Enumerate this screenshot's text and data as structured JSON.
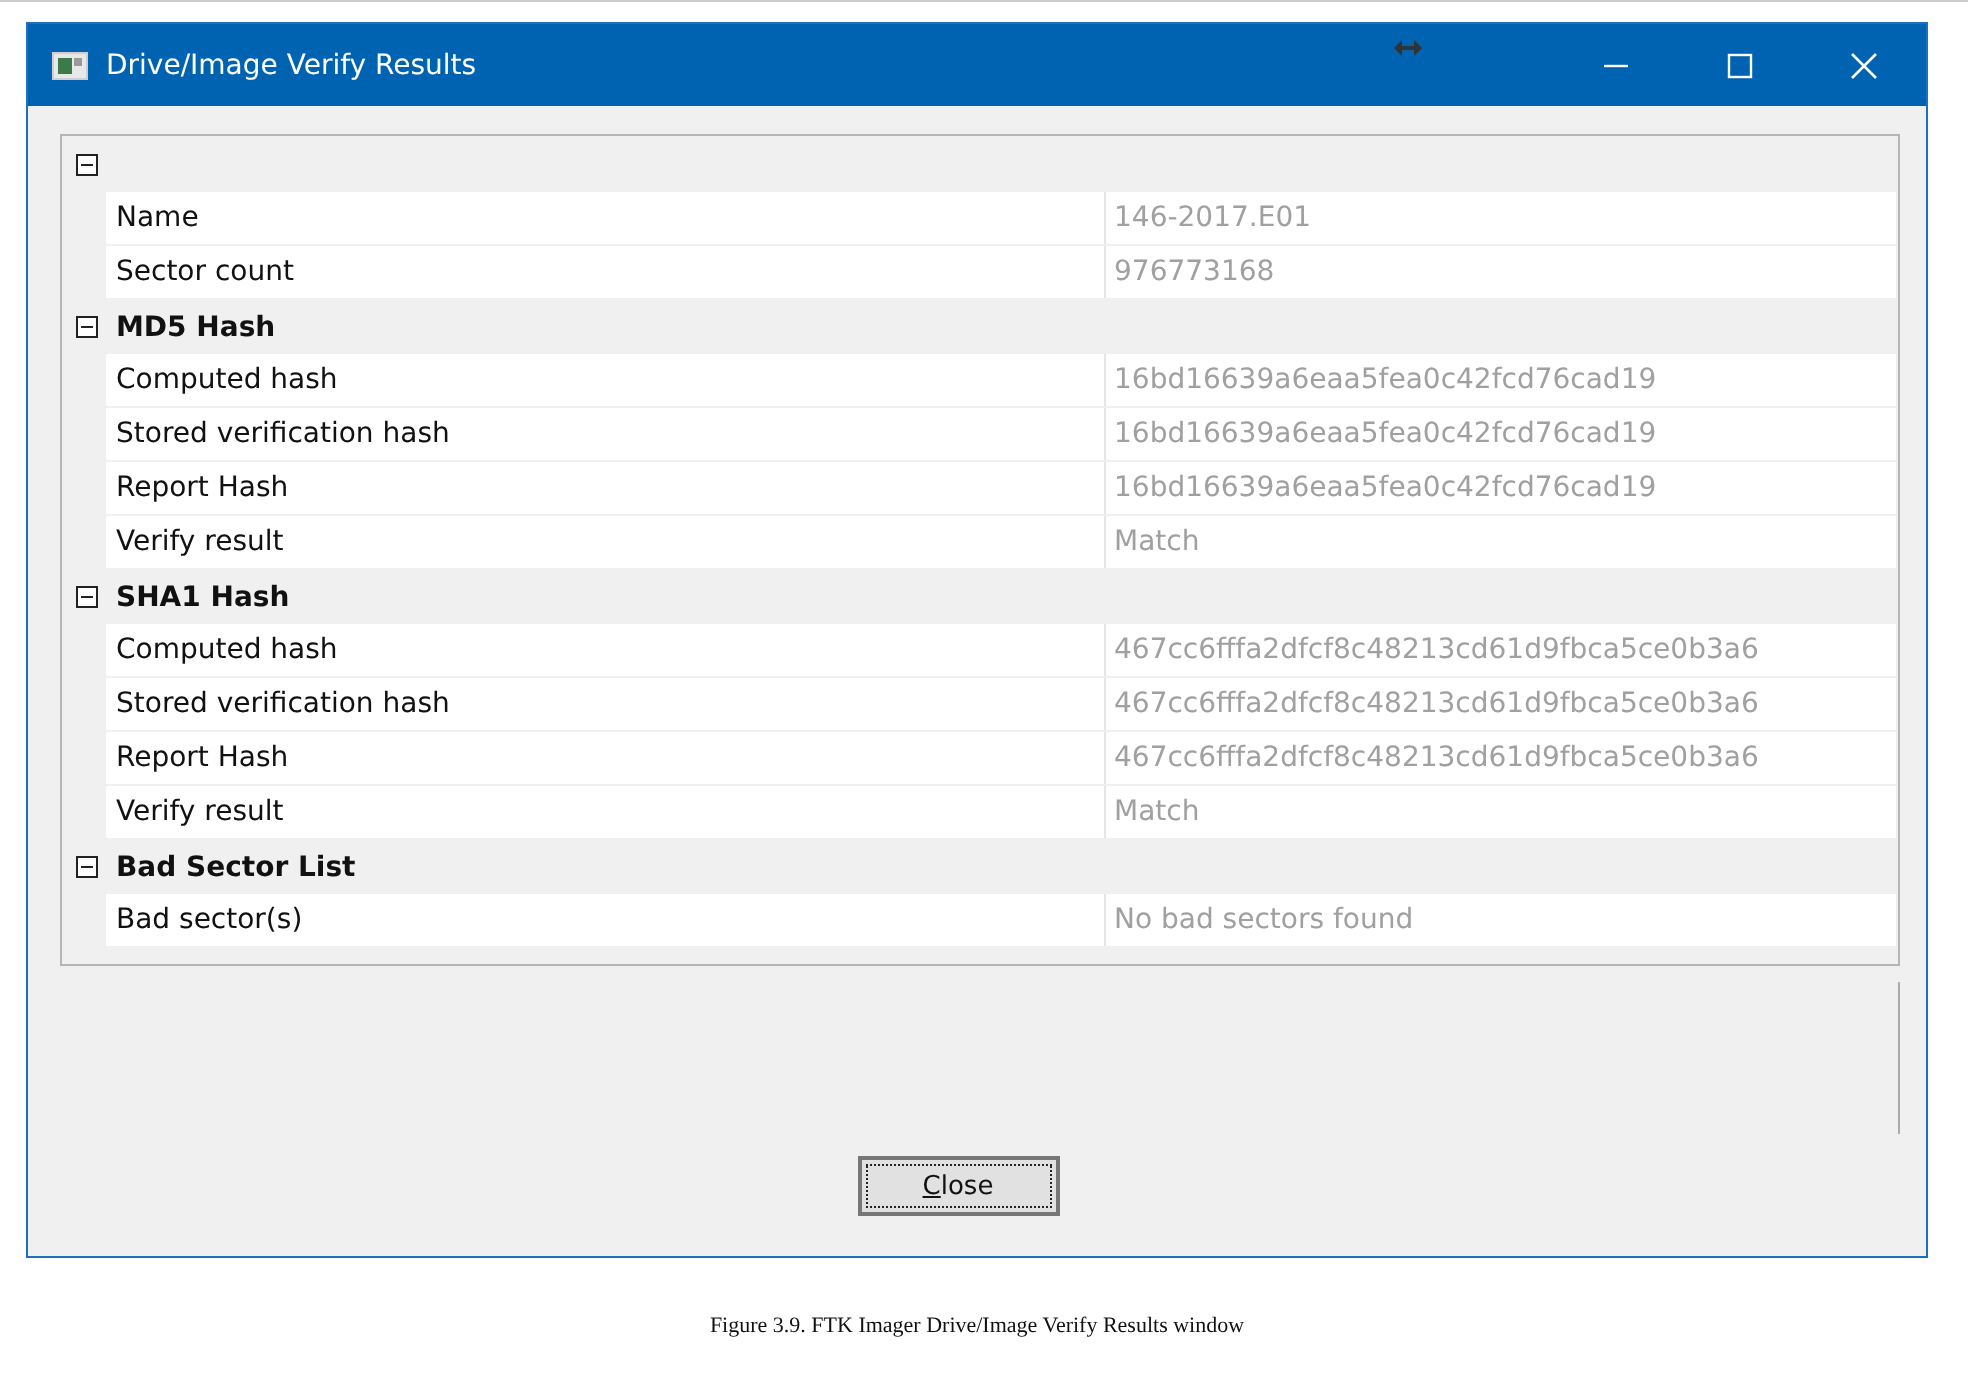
{
  "window": {
    "title": "Drive/Image Verify Results"
  },
  "groups": [
    {
      "expanded": true,
      "rows": [
        {
          "label": "Name",
          "value": "146-2017.E01"
        },
        {
          "label": "Sector count",
          "value": "976773168"
        }
      ]
    },
    {
      "title": "MD5 Hash",
      "expanded": true,
      "rows": [
        {
          "label": "Computed hash",
          "value": "16bd16639a6eaa5fea0c42fcd76cad19"
        },
        {
          "label": "Stored verification hash",
          "value": "16bd16639a6eaa5fea0c42fcd76cad19"
        },
        {
          "label": "Report Hash",
          "value": "16bd16639a6eaa5fea0c42fcd76cad19"
        },
        {
          "label": "Verify result",
          "value": "Match"
        }
      ]
    },
    {
      "title": "SHA1 Hash",
      "expanded": true,
      "rows": [
        {
          "label": "Computed hash",
          "value": "467cc6fffa2dfcf8c48213cd61d9fbca5ce0b3a6"
        },
        {
          "label": "Stored verification hash",
          "value": "467cc6fffa2dfcf8c48213cd61d9fbca5ce0b3a6"
        },
        {
          "label": "Report Hash",
          "value": "467cc6fffa2dfcf8c48213cd61d9fbca5ce0b3a6"
        },
        {
          "label": "Verify result",
          "value": "Match"
        }
      ]
    },
    {
      "title": "Bad Sector List",
      "expanded": true,
      "rows": [
        {
          "label": "Bad sector(s)",
          "value": "No bad sectors found"
        }
      ]
    }
  ],
  "buttons": [
    {
      "label": "Close"
    }
  ],
  "caption": "Figure 3.9. FTK Imager Drive/Image Verify Results window"
}
